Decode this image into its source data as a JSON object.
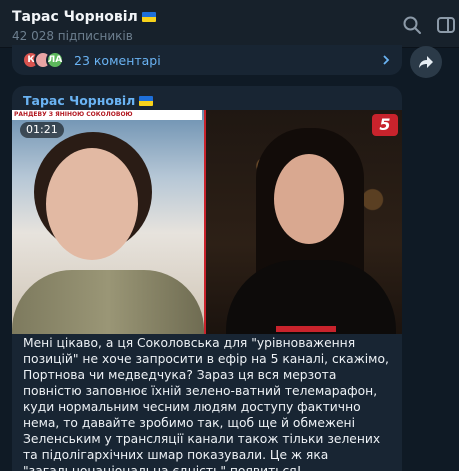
{
  "header": {
    "title": "Тарас Чорновіл",
    "subtitle": "42 028 підписників"
  },
  "prev_post": {
    "avatars": [
      "К",
      "",
      "ЛА"
    ],
    "comments_label": "23 коментарі"
  },
  "message": {
    "author": "Тарас Чорновіл",
    "video": {
      "strip_label": "РАНДЕВУ З ЯНІНОЮ СОКОЛОВОЮ",
      "time": "01:21",
      "channel_logo": "5"
    },
    "text": "Мені цікаво, а ця Соколовська для \"урівноваження позицій\" не хоче запросити в ефір на 5 каналі, скажімо, Портнова чи медведчука? Зараз ця вся мерзота повністю заповнює їхній зелено-ватний телемарафон, куди нормальним чесним людям доступу фактично нема, то давайте зробимо так, щоб ще й обмежені Зеленським у трансляції канали також тільки зелених та підолігархічних шмар показували. Це ж яка \"загальнонаціональна єдність\" появиться!"
  },
  "colors": {
    "bg": "#0e1621",
    "header": "#17212b",
    "bubble": "#182533",
    "accent": "#6ab3f3"
  }
}
